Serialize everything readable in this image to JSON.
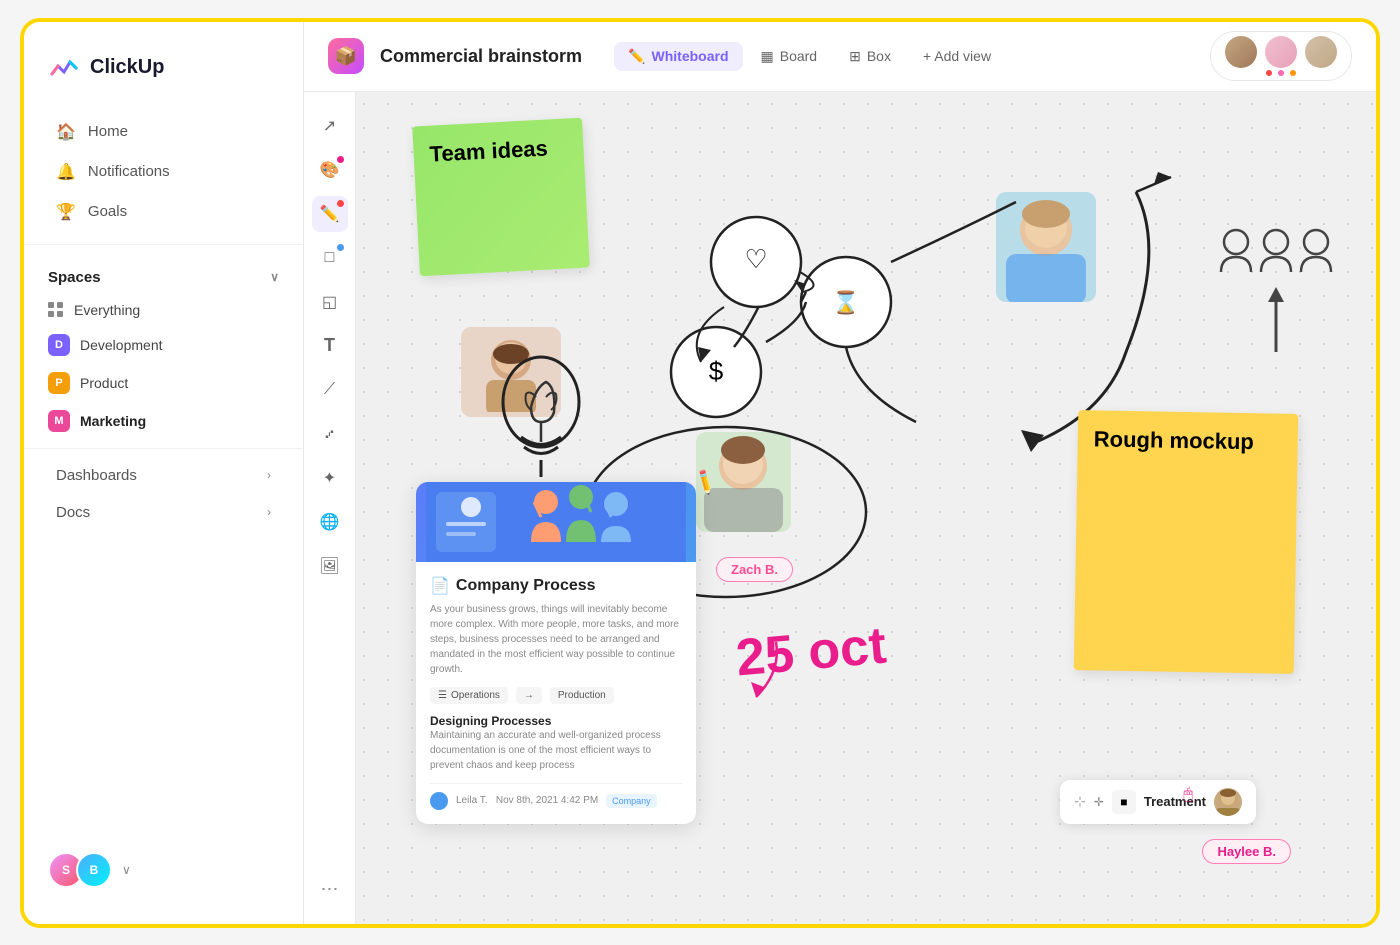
{
  "app": {
    "name": "ClickUp"
  },
  "sidebar": {
    "nav": [
      {
        "id": "home",
        "label": "Home",
        "icon": "🏠"
      },
      {
        "id": "notifications",
        "label": "Notifications",
        "icon": "🔔"
      },
      {
        "id": "goals",
        "label": "Goals",
        "icon": "🏆"
      }
    ],
    "spaces_label": "Spaces",
    "spaces": [
      {
        "id": "everything",
        "label": "Everything",
        "badge": null
      },
      {
        "id": "development",
        "label": "Development",
        "badge": "D",
        "badge_class": "badge-d"
      },
      {
        "id": "product",
        "label": "Product",
        "badge": "P",
        "badge_class": "badge-p"
      },
      {
        "id": "marketing",
        "label": "Marketing",
        "badge": "M",
        "badge_class": "badge-m"
      }
    ],
    "sections": [
      {
        "id": "dashboards",
        "label": "Dashboards"
      },
      {
        "id": "docs",
        "label": "Docs"
      }
    ]
  },
  "header": {
    "project_icon": "📦",
    "project_title": "Commercial brainstorm",
    "views": [
      {
        "id": "whiteboard",
        "label": "Whiteboard",
        "icon": "✏️",
        "active": true
      },
      {
        "id": "board",
        "label": "Board",
        "icon": "▦"
      },
      {
        "id": "box",
        "label": "Box",
        "icon": "⊞"
      }
    ],
    "add_view_label": "+ Add view"
  },
  "toolbar": {
    "tools": [
      {
        "id": "select",
        "icon": "↗",
        "label": "Select"
      },
      {
        "id": "color",
        "icon": "🎨",
        "label": "Color palette",
        "dot": "#e91e8c"
      },
      {
        "id": "pen",
        "icon": "✏️",
        "label": "Pen",
        "active": true,
        "dot": "#ff4444"
      },
      {
        "id": "shape",
        "icon": "□",
        "label": "Shape",
        "dot": "#4a9af0"
      },
      {
        "id": "sticky",
        "icon": "◱",
        "label": "Sticky note",
        "dot": "#ffd54f"
      },
      {
        "id": "text",
        "icon": "T",
        "label": "Text"
      },
      {
        "id": "eraser",
        "icon": "⟋",
        "label": "Eraser"
      },
      {
        "id": "connect",
        "icon": "⑇",
        "label": "Connect"
      },
      {
        "id": "ai",
        "icon": "✦",
        "label": "AI"
      },
      {
        "id": "globe",
        "icon": "🌐",
        "label": "Globe"
      },
      {
        "id": "image",
        "icon": "🖼️",
        "label": "Image"
      }
    ],
    "more": "..."
  },
  "canvas": {
    "sticky_green": {
      "text": "Team ideas",
      "color": "#a8e063"
    },
    "sticky_yellow": {
      "text": "Rough mockup",
      "color": "#ffd54f"
    },
    "date_text": "25 oct",
    "doc_card": {
      "title": "Company Process",
      "description": "As your business grows, things will inevitably become more complex. With more people, more tasks, and more steps, business processes need to be arranged and mandated in the most efficient way possible to continue growth.",
      "tags": [
        "Operations",
        "→",
        "Production"
      ],
      "section": "Designing Processes",
      "section_text": "Maintaining an accurate and well-organized process documentation is one of the most efficient ways to prevent chaos and keep process",
      "author": "Leila T.",
      "date": "Nov 8th, 2021 4:42 PM",
      "badge": "Company"
    },
    "treatment_card": {
      "title": "Treatment"
    },
    "name_tags": [
      {
        "label": "Zach B."
      },
      {
        "label": "Haylee B."
      }
    ],
    "header_avatars": [
      "Person 1",
      "Person 2",
      "Person 3"
    ]
  }
}
